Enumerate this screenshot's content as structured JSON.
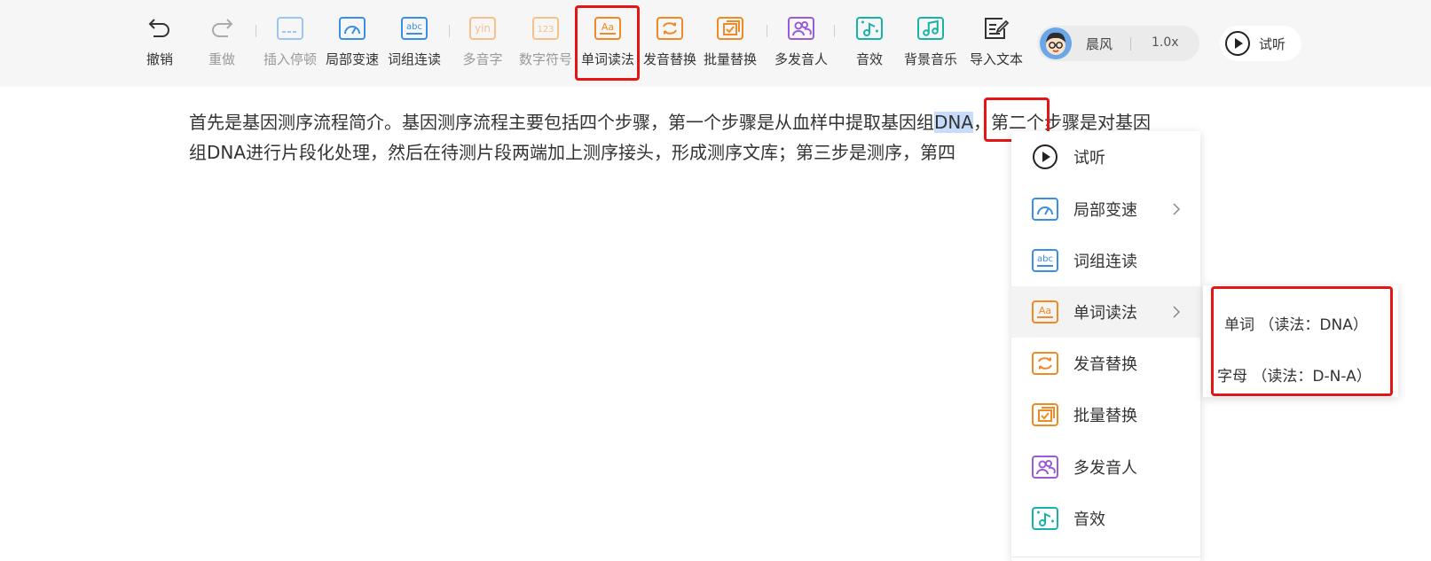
{
  "toolbar": {
    "undo": "撤销",
    "redo": "重做",
    "insert_pause": "插入停顿",
    "local_speed": "局部变速",
    "phrase_link": "词组连读",
    "polyphone": "多音字",
    "number_symbol": "数字符号",
    "word_reading": "单词读法",
    "pron_replace": "发音替换",
    "batch_replace": "批量替换",
    "multi_speaker": "多发音人",
    "sound_effect": "音效",
    "bg_music": "背景音乐",
    "import_text": "导入文本",
    "yin_glyph": "yin",
    "num_glyph": "123",
    "abc_glyph": "abc",
    "aa_glyph": "Aa"
  },
  "voice": {
    "name": "晨风",
    "speed": "1.0x"
  },
  "preview": {
    "label": "试听"
  },
  "content": {
    "line1_before": "首先是基因测序流程简介。基因测序流程主要包括四个步骤，第一个步骤是从血样中提取基因组",
    "line1_selected": "DNA",
    "line1_after": "，第二个步骤是对基因",
    "line2": "组DNA进行片段化处理，然后在待测片段两端加上测序接头，形成测序文库；第三步是测序，第四"
  },
  "context_menu": {
    "items": [
      {
        "label": "试听"
      },
      {
        "label": "局部变速"
      },
      {
        "label": "词组连读"
      },
      {
        "label": "单词读法"
      },
      {
        "label": "发音替换"
      },
      {
        "label": "批量替换"
      },
      {
        "label": "多发音人"
      },
      {
        "label": "音效"
      }
    ]
  },
  "submenu": {
    "items": [
      {
        "label": "单词 （读法：DNA）"
      },
      {
        "label": "字母 （读法：D-N-A）"
      }
    ]
  },
  "colors": {
    "blue": "#3a8ee6",
    "orange": "#f08a24",
    "orange_light": "#f7c08a",
    "purple": "#9a5bd8",
    "teal": "#17b3a6",
    "highlight": "#e41515",
    "selection": "#c7dcfb"
  }
}
